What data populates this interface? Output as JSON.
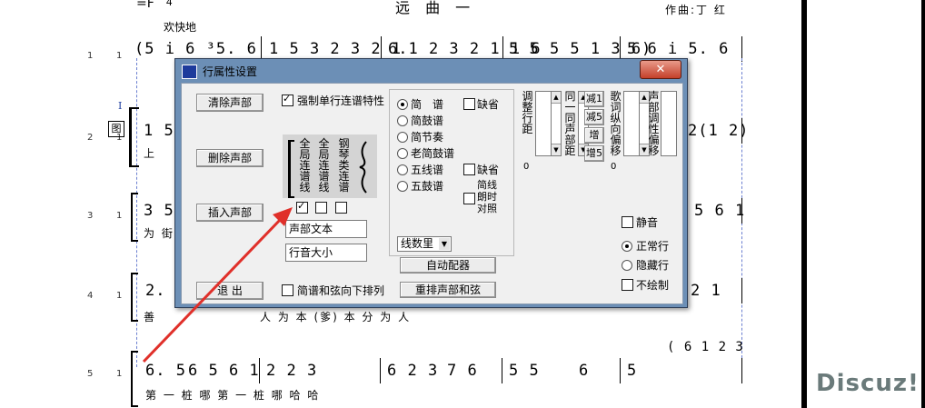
{
  "score": {
    "title": "远 曲 一",
    "author": "作曲:丁  红",
    "tempo_mark": "欢快地",
    "meter_fragment": "=F",
    "meter_den": "4",
    "line_numbers": [
      "1",
      "1",
      "2",
      "1",
      "3",
      "1",
      "4",
      "1",
      "5",
      "1"
    ],
    "row1": [
      "(5  i 6 ³5. 6",
      "1 5 3  2 3 2 1",
      "6.1 2 3  2 1 1 6",
      "5  5 5  5 1 3 6)",
      "5  6  i   5. 6"
    ],
    "row2_start": "1  5",
    "row2_end": "2(1 2)",
    "row2_lyric": "上",
    "row3_start": "3  5",
    "row3_end": "5 6 1",
    "row3_lyric": "为 街",
    "row4_start": "2.",
    "row4_end": "2  1",
    "row4_lyric": "善",
    "row4_lyrics_mid": "人 为          本          (爹) 本 分            为 人",
    "row5": [
      "6. 5",
      "6 5 6 1",
      "2   2     3",
      "6  2 3",
      "7  6",
      "5    5",
      "6",
      "5"
    ],
    "row5_tail": "( 6 1 2 3",
    "row5_lyrics": "第   一      桩   哪            第   一      桩   哪    哈    哈",
    "marker_I": "I",
    "marker_box": "图",
    "watermark": "Discuz!"
  },
  "dialog": {
    "title": "行属性设置",
    "close_label": "✕",
    "buttons": {
      "clear_voice": "清除声部",
      "delete_voice": "删除声部",
      "insert_voice": "插入声部",
      "exit": "退 出",
      "auto_chord": "自动配器",
      "rearrange": "重排声部和弦"
    },
    "force_slur": "强制单行连谱特性",
    "brace_labels": {
      "full_slur_line": "全局连谱线",
      "full_slur": "全局连谱线",
      "piano_slur": "钢琴类连谱"
    },
    "voice_text_field": "声部文本",
    "line_size_field": "行音大小",
    "notation_options": [
      "简　谱",
      "简鼓谱",
      "简节奏",
      "老简鼓谱",
      "五线谱",
      "五鼓谱"
    ],
    "default_checkbox": "缺省",
    "default_checkbox2": "缺省",
    "stave_compare": "简线朗时对照",
    "line_count_select": "线数里",
    "adjust_spacing": "调整行距",
    "same_voice_spacing": "同一同声部距",
    "reduce1": "减1",
    "reduce5": "减5",
    "increase": "增",
    "increase5": "增5",
    "lyric_offset": "歌词纵向偏移",
    "voice_offset": "声部调性偏移",
    "value_0a": "0",
    "value_0b": "0",
    "mute": "静音",
    "line_modes": [
      "正常行",
      "隐藏行"
    ],
    "no_draw": "不绘制",
    "stave_bottom": "简谱和弦向下排列"
  },
  "colors": {
    "titlebar": "#6c8fb6",
    "close": "#c4402a",
    "arrow": "#e0302a",
    "client": "#f0f0f0"
  }
}
